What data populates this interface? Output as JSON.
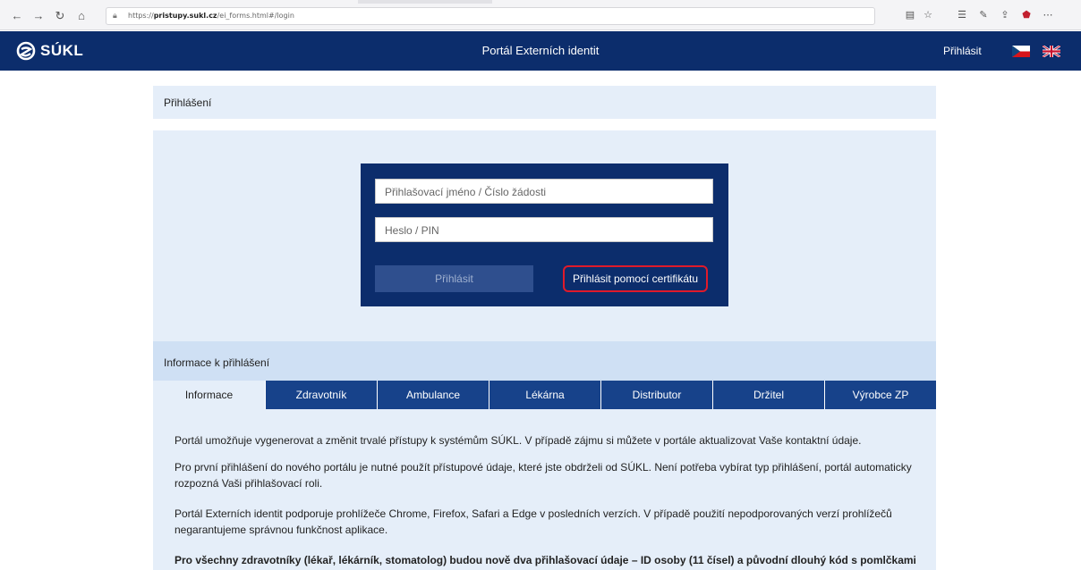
{
  "browser": {
    "url_prefix": "https://",
    "url_host": "pristupy.sukl.cz",
    "url_path": "/ei_forms.html#/login"
  },
  "header": {
    "logo_text": "SÚKL",
    "title": "Portál Externích identit",
    "login_link": "Přihlásit"
  },
  "breadcrumb": "Přihlášení",
  "login": {
    "username_placeholder": "Přihlašovací jméno / Číslo žádosti",
    "password_placeholder": "Heslo / PIN",
    "login_button": "Přihlásit",
    "cert_button": "Přihlásit pomocí certifikátu"
  },
  "info": {
    "header": "Informace k přihlášení",
    "tabs": [
      {
        "label": "Informace",
        "active": true
      },
      {
        "label": "Zdravotník",
        "active": false
      },
      {
        "label": "Ambulance",
        "active": false
      },
      {
        "label": "Lékárna",
        "active": false
      },
      {
        "label": "Distributor",
        "active": false
      },
      {
        "label": "Držitel",
        "active": false
      },
      {
        "label": "Výrobce ZP",
        "active": false
      }
    ],
    "paragraphs": [
      "Portál umožňuje vygenerovat a změnit trvalé přístupy k systémům SÚKL. V případě zájmu si můžete v portále aktualizovat Vaše kontaktní údaje.",
      "Pro první přihlášení do nového portálu je nutné použít přístupové údaje, které jste obdrželi od SÚKL. Není potřeba vybírat typ přihlášení, portál automaticky rozpozná Vaši přihlašovací roli.",
      "Portál Externích identit podporuje prohlížeče Chrome, Firefox, Safari a Edge v posledních verzích. V případě použití nepodporovaných verzí prohlížečů negarantujeme správnou funkčnost aplikace.",
      "Pro všechny zdravotníky (lékař, lékárník, stomatolog) budou nově dva přihlašovací údaje – ID osoby (11 čísel) a původní dlouhý kód s pomlčkami"
    ]
  },
  "colors": {
    "brand_navy": "#0c2d6c",
    "panel_light": "#e5eef9",
    "panel_mid": "#cfe0f4",
    "tab_blue": "#17428a",
    "highlight_red": "#e01a2a"
  }
}
